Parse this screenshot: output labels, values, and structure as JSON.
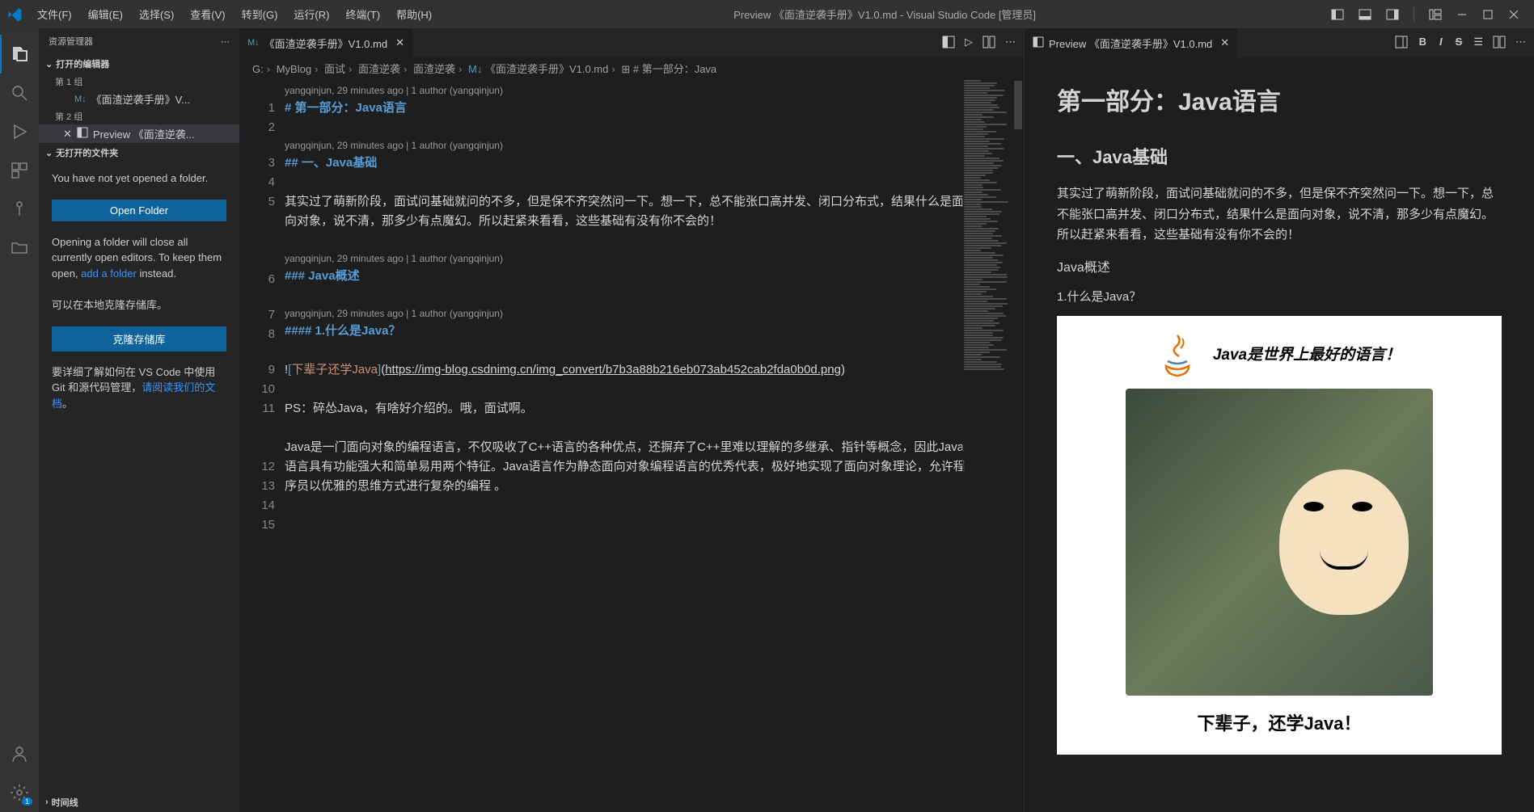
{
  "titlebar": {
    "menus": [
      "文件(F)",
      "编辑(E)",
      "选择(S)",
      "查看(V)",
      "转到(G)",
      "运行(R)",
      "终端(T)",
      "帮助(H)"
    ],
    "title": "Preview 《面渣逆袭手册》V1.0.md - Visual Studio Code [管理员]"
  },
  "sidebar": {
    "header": "资源管理器",
    "open_editors": "打开的编辑器",
    "group1": "第 1 组",
    "group2": "第 2 组",
    "file1": "《面渣逆袭手册》V...",
    "file1_icon": "M↓",
    "file2": "Preview 《面渣逆袭...",
    "no_folder": "无打开的文件夹",
    "not_opened": "You have not yet opened a folder.",
    "open_folder_btn": "Open Folder",
    "open_hint_1": "Opening a folder will close all currently open editors. To keep them open, ",
    "open_hint_link": "add a folder",
    "open_hint_2": " instead.",
    "clone_hint": "可以在本地克隆存储库。",
    "clone_btn": "克隆存储库",
    "git_hint_1": "要详细了解如何在 VS Code 中使用 Git 和源代码管理，",
    "git_hint_link": "请阅读我们的文档",
    "git_hint_2": "。",
    "timeline": "时间线"
  },
  "tabs": {
    "left_tab": "《面渣逆袭手册》V1.0.md",
    "left_icon": "M↓",
    "right_tab": "Preview 《面渣逆袭手册》V1.0.md"
  },
  "breadcrumb": {
    "parts": [
      "G:",
      "MyBlog",
      "面试",
      "面渣逆袭",
      "面渣逆袭",
      "M↓",
      "《面渣逆袭手册》V1.0.md",
      "⊞ # 第一部分：Java"
    ]
  },
  "codelens": "yangqinjun, 29 minutes ago | 1 author (yangqinjun)",
  "code": {
    "l1": "# 第一部分：Java语言",
    "l3": "## 一、Java基础",
    "l5": "其实过了萌新阶段，面试问基础就问的不多，但是保不齐突然问一下。想一下，总不能张口高并发、闭口分布式，结果什么是面向对象，说不清，那多少有点魔幻。所以赶紧来看看，这些基础有没有你不会的！",
    "l7": "### Java概述",
    "l9": "#### 1.什么是Java？",
    "l11_pre": "!",
    "l11_text": "下辈子还学Java",
    "l11_url": "https://img-blog.csdnimg.cn/img_convert/b7b3a88b216eb073ab452cab2fda0b0d.png",
    "l13": "PS：碎怂Java，有啥好介绍的。哦，面试啊。",
    "l15": "Java是一门面向对象的编程语言，不仅吸收了C++语言的各种优点，还摒弃了C++里难以理解的多继承、指针等概念，因此Java语言具有功能强大和简单易用两个特征。Java语言作为静态面向对象编程语言的优秀代表，极好地实现了面向对象理论，允许程序员以优雅的思维方式进行复杂的编程 。"
  },
  "line_numbers": [
    "1",
    "2",
    "3",
    "4",
    "5",
    "6",
    "7",
    "8",
    "9",
    "10",
    "11",
    "",
    "",
    "12",
    "13",
    "14",
    "15"
  ],
  "preview": {
    "h1": "第一部分：Java语言",
    "h2": "一、Java基础",
    "p1": "其实过了萌新阶段，面试问基础就问的不多，但是保不齐突然问一下。想一下，总不能张口高并发、闭口分布式，结果什么是面向对象，说不清，那多少有点魔幻。所以赶紧来看看，这些基础有没有你不会的！",
    "h3": "Java概述",
    "h4": "1.什么是Java？",
    "img_top": "Java是世界上最好的语言！",
    "img_bottom": "下辈子，还学Java！"
  },
  "preview_toolbar": [
    "B",
    "I",
    "S"
  ]
}
